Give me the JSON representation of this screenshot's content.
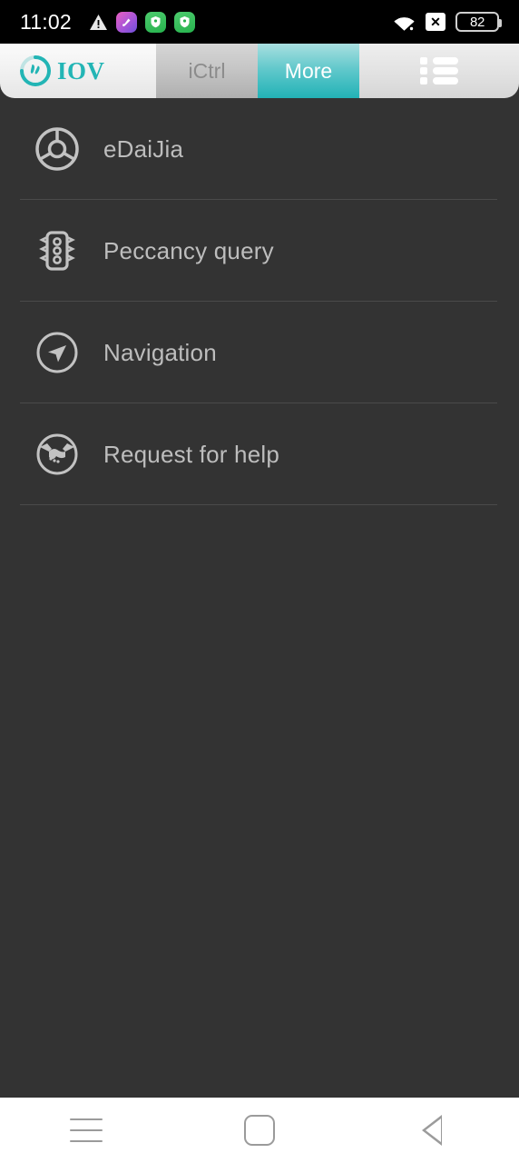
{
  "status_bar": {
    "time": "11:02",
    "left_icons": [
      {
        "name": "warning-triangle-icon",
        "label": "warning"
      },
      {
        "name": "app-notification-violet-icon",
        "label": "app"
      },
      {
        "name": "security-shield-green-icon",
        "label": "security"
      },
      {
        "name": "security-shield-green-2-icon",
        "label": "security"
      }
    ],
    "right_icons": [
      {
        "name": "wifi-icon",
        "label": "wifi"
      },
      {
        "name": "no-sim-icon",
        "label": "x"
      }
    ],
    "battery_level": "82"
  },
  "header": {
    "logo_text": "IOV",
    "logo_icon": "iov-circular-logo-icon",
    "tabs": [
      {
        "label": "iCtrl",
        "active": false
      },
      {
        "label": "More",
        "active": true
      }
    ],
    "menu_icon": "list-menu-icon",
    "accent_color": "#22b2b6",
    "inactive_tab_color": "#8c8c8c"
  },
  "main": {
    "items": [
      {
        "label": "eDaiJia",
        "icon": "steering-wheel-icon"
      },
      {
        "label": "Peccancy query",
        "icon": "traffic-light-icon"
      },
      {
        "label": "Navigation",
        "icon": "navigation-arrow-icon"
      },
      {
        "label": "Request for help",
        "icon": "handshake-icon"
      }
    ],
    "background_color": "#333333",
    "text_color": "#bdbdbd",
    "separator_color": "#4a4a4a"
  },
  "nav_bar": {
    "buttons": [
      {
        "name": "recents-button",
        "icon": "hamburger-icon"
      },
      {
        "name": "home-button",
        "icon": "rounded-square-icon"
      },
      {
        "name": "back-button",
        "icon": "triangle-left-icon"
      }
    ]
  }
}
